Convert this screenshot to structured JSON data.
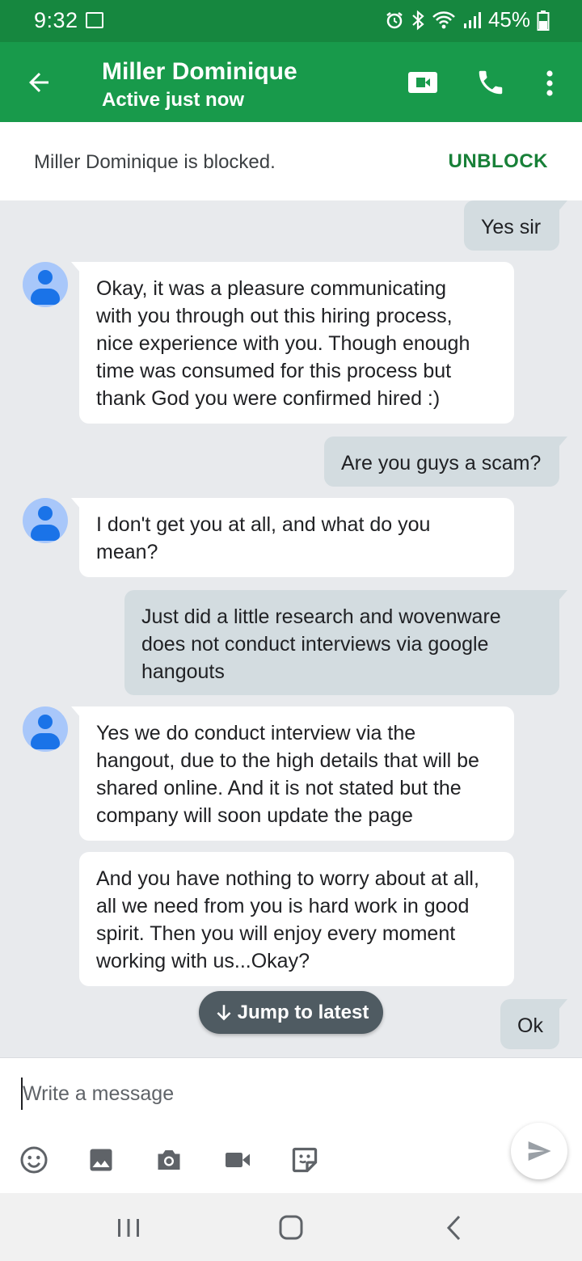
{
  "status_bar": {
    "time": "9:32",
    "battery": "45%"
  },
  "header": {
    "contact_name": "Miller Dominique",
    "contact_status": "Active just now",
    "icons": [
      "back-arrow-icon",
      "video-call-icon",
      "phone-icon",
      "more-vert-icon"
    ]
  },
  "banner": {
    "text": "Miller Dominique is blocked.",
    "action": "UNBLOCK"
  },
  "messages": [
    {
      "dir": "out",
      "lines": [
        "Yes sir"
      ]
    },
    {
      "dir": "in",
      "lines": [
        "Okay, it was a pleasure communicating",
        "with you through out this hiring process,",
        "nice experience with you. Though enough",
        "time was consumed for this process but",
        "thank God you were confirmed hired :)"
      ]
    },
    {
      "dir": "out",
      "lines": [
        "Are you guys a scam?"
      ]
    },
    {
      "dir": "in",
      "lines": [
        "I don't get you at all, and what do you",
        "mean?"
      ]
    },
    {
      "dir": "out",
      "lines": [
        "Just did a little research and wovenware",
        "does not conduct interviews via google",
        "hangouts"
      ]
    },
    {
      "dir": "in",
      "lines": [
        "Yes we do conduct  interview via the",
        "hangout, due to the high details that will be",
        "shared online. And it is not stated but the",
        "company will soon update the page"
      ]
    },
    {
      "dir": "in",
      "lines": [
        "And you have nothing to worry about at all,",
        "all we need from you is hard work in good",
        "spirit. Then you will enjoy every moment",
        "working with us...Okay?"
      ]
    },
    {
      "dir": "out",
      "lines": [
        "Ok"
      ]
    }
  ],
  "jump_button": "Jump to latest",
  "composer": {
    "placeholder": "Write a message",
    "tools": [
      "emoji-icon",
      "image-icon",
      "camera-icon",
      "video-icon",
      "sticker-icon"
    ],
    "send_icon": "send-icon"
  },
  "colors": {
    "status_bar": "#16873f",
    "app_bar": "#189a4b",
    "accent": "#188038",
    "outgoing_bubble": "#d3dce0",
    "incoming_bubble": "#ffffff",
    "chat_background": "#e8eaed"
  }
}
